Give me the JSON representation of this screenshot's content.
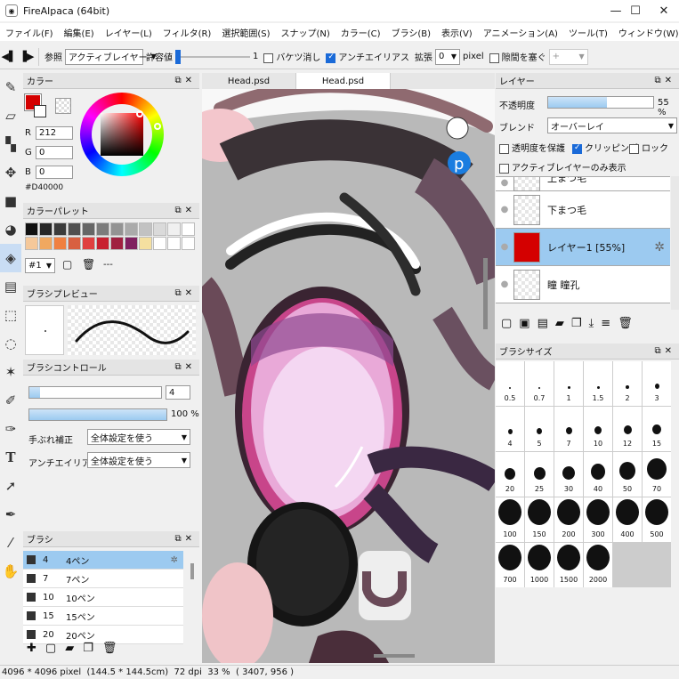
{
  "window": {
    "title": "FireAlpaca (64bit)",
    "minimize": "—",
    "maximize": "☐",
    "close": "✕"
  },
  "menu": [
    "ファイル(F)",
    "編集(E)",
    "レイヤー(L)",
    "フィルタ(R)",
    "選択範囲(S)",
    "スナップ(N)",
    "カラー(C)",
    "ブラシ(B)",
    "表示(V)",
    "アニメーション(A)",
    "ツール(T)",
    "ウィンドウ(W)",
    "Help"
  ],
  "toolbar": {
    "ref_label": "参照",
    "ref_value": "アクティブレイヤー",
    "tolerance_label": "許容値",
    "tolerance_value": "1",
    "bucket_erase_label": "バケツ消し",
    "bucket_erase_checked": false,
    "antialias_label": "アンチエイリアス",
    "antialias_checked": true,
    "expand_label": "拡張",
    "expand_value": "0",
    "expand_unit": "pixel",
    "gap_label": "隙間を塞ぐ",
    "gap_checked": false,
    "gap_value": "+"
  },
  "color_panel": {
    "title": "カラー",
    "r_label": "R",
    "r": "212",
    "g_label": "G",
    "g": "0",
    "b_label": "B",
    "b": "0",
    "hex": "#D40000",
    "primary": "#d40000"
  },
  "palette_panel": {
    "title": "カラーパレット",
    "colors": [
      "#111111",
      "#262626",
      "#3b3b3b",
      "#505050",
      "#666666",
      "#7c7c7c",
      "#939393",
      "#aaaaaa",
      "#c2c2c2",
      "#dadada",
      "#f0f0f0",
      "#ffffff",
      "#f5c89a",
      "#f0a860",
      "#f08040",
      "#d86040",
      "#e04040",
      "#c82030",
      "#a02040",
      "#802060",
      "#f5e0a0",
      "#ffffff",
      "#ffffff",
      "#ffffff"
    ],
    "set_value": "#1",
    "dash": "---"
  },
  "brush_preview": {
    "title": "ブラシプレビュー"
  },
  "brush_control": {
    "title": "ブラシコントロール",
    "size": "4",
    "opacity": "100",
    "opacity_unit": "%",
    "stabilizer_label": "手ぶれ補正",
    "stabilizer_value": "全体設定を使う",
    "aa_label": "アンチエイリアス",
    "aa_value": "全体設定を使う"
  },
  "brush_panel": {
    "title": "ブラシ",
    "items": [
      {
        "num": "4",
        "name": "4ペン",
        "selected": true
      },
      {
        "num": "7",
        "name": "7ペン",
        "selected": false
      },
      {
        "num": "10",
        "name": "10ペン",
        "selected": false
      },
      {
        "num": "15",
        "name": "15ペン",
        "selected": false
      },
      {
        "num": "20",
        "name": "20ペン",
        "selected": false
      }
    ]
  },
  "tabs": [
    "Head.psd",
    "Head.psd"
  ],
  "layer_panel": {
    "title": "レイヤー",
    "opacity_label": "不透明度",
    "opacity_value": "55",
    "opacity_unit": "%",
    "blend_label": "ブレンド",
    "blend_value": "オーバーレイ",
    "protect_alpha_label": "透明度を保護",
    "protect_alpha": false,
    "clipping_label": "クリッピング",
    "clipping": true,
    "lock_label": "ロック",
    "lock": false,
    "active_only_label": "アクティブレイヤーのみ表示",
    "active_only": false,
    "layers": [
      {
        "name": "下まつ毛",
        "selected": false
      },
      {
        "name": "レイヤー1 [55%]",
        "selected": true
      },
      {
        "name": "瞳 瞳孔",
        "selected": false
      }
    ],
    "partial_top_layer": "上まつ毛"
  },
  "brush_size_panel": {
    "title": "ブラシサイズ",
    "sizes": [
      "0.5",
      "0.7",
      "1",
      "1.5",
      "2",
      "3",
      "4",
      "5",
      "7",
      "10",
      "12",
      "15",
      "20",
      "25",
      "30",
      "40",
      "50",
      "70",
      "100",
      "150",
      "200",
      "300",
      "400",
      "500",
      "700",
      "1000",
      "1500",
      "2000"
    ]
  },
  "status": {
    "dims": "4096 * 4096 pixel",
    "cm": "(144.5 * 144.5cm)",
    "dpi": "72 dpi",
    "zoom": "33 %",
    "coords": "( 3407, 956 )"
  }
}
